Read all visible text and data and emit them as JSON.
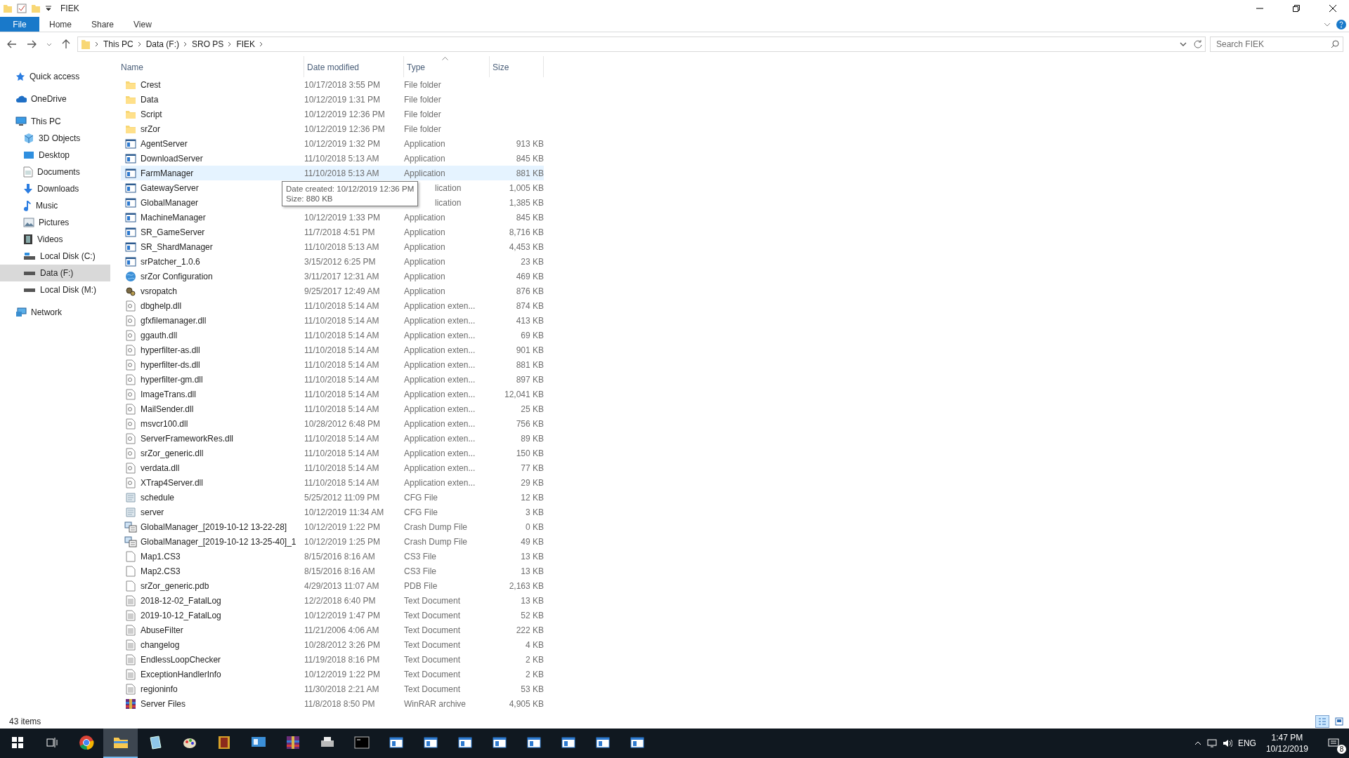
{
  "window": {
    "title": "FIEK"
  },
  "ribbon_tabs": [
    {
      "label": "File",
      "kind": "file"
    },
    {
      "label": "Home",
      "kind": "tab"
    },
    {
      "label": "Share",
      "kind": "tab"
    },
    {
      "label": "View",
      "kind": "tab"
    }
  ],
  "address": {
    "path": [
      "This PC",
      "Data (F:)",
      "SRO PS",
      "FIEK"
    ]
  },
  "search": {
    "placeholder": "Search FIEK"
  },
  "sidebar": {
    "items": [
      {
        "label": "Quick access",
        "selected": false
      },
      {
        "label": "OneDrive",
        "selected": false
      },
      {
        "label": "This PC",
        "selected": false,
        "children": [
          {
            "label": "3D Objects",
            "selected": false
          },
          {
            "label": "Desktop",
            "selected": false
          },
          {
            "label": "Documents",
            "selected": false
          },
          {
            "label": "Downloads",
            "selected": false
          },
          {
            "label": "Music",
            "selected": false
          },
          {
            "label": "Pictures",
            "selected": false
          },
          {
            "label": "Videos",
            "selected": false
          },
          {
            "label": "Local Disk (C:)",
            "selected": false
          },
          {
            "label": "Data (F:)",
            "selected": true
          },
          {
            "label": "Local Disk (M:)",
            "selected": false
          }
        ]
      },
      {
        "label": "Network",
        "selected": false
      }
    ]
  },
  "table": {
    "columns": [
      {
        "label": "Name",
        "sorted": false
      },
      {
        "label": "Date modified",
        "sorted": false
      },
      {
        "label": "Type",
        "sorted": true
      },
      {
        "label": "Size",
        "sorted": false
      }
    ],
    "rows": [
      {
        "name": "Crest",
        "modified": "10/17/2018 3:55 PM",
        "type": "File folder",
        "kind": "folder",
        "selected": false
      },
      {
        "name": "Data",
        "modified": "10/12/2019 1:31 PM",
        "type": "File folder",
        "kind": "folder",
        "selected": false
      },
      {
        "name": "Script",
        "modified": "10/12/2019 12:36 PM",
        "type": "File folder",
        "kind": "folder",
        "selected": false
      },
      {
        "name": "srZor",
        "modified": "10/12/2019 12:36 PM",
        "type": "File folder",
        "kind": "folder",
        "selected": false
      },
      {
        "name": "AgentServer",
        "modified": "10/12/2019 1:32 PM",
        "type": "Application",
        "size": "913 KB",
        "kind": "app",
        "selected": false
      },
      {
        "name": "DownloadServer",
        "modified": "11/10/2018 5:13 AM",
        "type": "Application",
        "size": "845 KB",
        "kind": "app",
        "selected": false
      },
      {
        "name": "FarmManager",
        "modified": "11/10/2018 5:13 AM",
        "type": "Application",
        "size": "881 KB",
        "kind": "app",
        "selected": true
      },
      {
        "name": "GatewayServer",
        "type": "lication",
        "size": "1,005 KB",
        "kind": "app",
        "selected": false
      },
      {
        "name": "GlobalManager",
        "type": "lication",
        "size": "1,385 KB",
        "kind": "app",
        "selected": false
      },
      {
        "name": "MachineManager",
        "modified": "10/12/2019 1:33 PM",
        "type": "Application",
        "size": "845 KB",
        "kind": "app",
        "selected": false
      },
      {
        "name": "SR_GameServer",
        "modified": "11/7/2018 4:51 PM",
        "type": "Application",
        "size": "8,716 KB",
        "kind": "app",
        "selected": false
      },
      {
        "name": "SR_ShardManager",
        "modified": "11/10/2018 5:13 AM",
        "type": "Application",
        "size": "4,453 KB",
        "kind": "app",
        "selected": false
      },
      {
        "name": "srPatcher_1.0.6",
        "modified": "3/15/2012 6:25 PM",
        "type": "Application",
        "size": "23 KB",
        "kind": "app",
        "selected": false
      },
      {
        "name": "srZor Configuration",
        "modified": "3/11/2017 12:31 AM",
        "type": "Application",
        "size": "469 KB",
        "kind": "globe",
        "selected": false
      },
      {
        "name": "vsropatch",
        "modified": "9/25/2017 12:49 AM",
        "type": "Application",
        "size": "876 KB",
        "kind": "gears",
        "selected": false
      },
      {
        "name": "dbghelp.dll",
        "modified": "11/10/2018 5:14 AM",
        "type": "Application exten...",
        "size": "874 KB",
        "kind": "dll",
        "selected": false
      },
      {
        "name": "gfxfilemanager.dll",
        "modified": "11/10/2018 5:14 AM",
        "type": "Application exten...",
        "size": "413 KB",
        "kind": "dll",
        "selected": false
      },
      {
        "name": "ggauth.dll",
        "modified": "11/10/2018 5:14 AM",
        "type": "Application exten...",
        "size": "69 KB",
        "kind": "dll",
        "selected": false
      },
      {
        "name": "hyperfilter-as.dll",
        "modified": "11/10/2018 5:14 AM",
        "type": "Application exten...",
        "size": "901 KB",
        "kind": "dll",
        "selected": false
      },
      {
        "name": "hyperfilter-ds.dll",
        "modified": "11/10/2018 5:14 AM",
        "type": "Application exten...",
        "size": "881 KB",
        "kind": "dll",
        "selected": false
      },
      {
        "name": "hyperfilter-gm.dll",
        "modified": "11/10/2018 5:14 AM",
        "type": "Application exten...",
        "size": "897 KB",
        "kind": "dll",
        "selected": false
      },
      {
        "name": "ImageTrans.dll",
        "modified": "11/10/2018 5:14 AM",
        "type": "Application exten...",
        "size": "12,041 KB",
        "kind": "dll",
        "selected": false
      },
      {
        "name": "MailSender.dll",
        "modified": "11/10/2018 5:14 AM",
        "type": "Application exten...",
        "size": "25 KB",
        "kind": "dll",
        "selected": false
      },
      {
        "name": "msvcr100.dll",
        "modified": "10/28/2012 6:48 PM",
        "type": "Application exten...",
        "size": "756 KB",
        "kind": "dll",
        "selected": false
      },
      {
        "name": "ServerFrameworkRes.dll",
        "modified": "11/10/2018 5:14 AM",
        "type": "Application exten...",
        "size": "89 KB",
        "kind": "dll",
        "selected": false
      },
      {
        "name": "srZor_generic.dll",
        "modified": "11/10/2018 5:14 AM",
        "type": "Application exten...",
        "size": "150 KB",
        "kind": "dll",
        "selected": false
      },
      {
        "name": "verdata.dll",
        "modified": "11/10/2018 5:14 AM",
        "type": "Application exten...",
        "size": "77 KB",
        "kind": "dll",
        "selected": false
      },
      {
        "name": "XTrap4Server.dll",
        "modified": "11/10/2018 5:14 AM",
        "type": "Application exten...",
        "size": "29 KB",
        "kind": "dll",
        "selected": false
      },
      {
        "name": "schedule",
        "modified": "5/25/2012 11:09 PM",
        "type": "CFG File",
        "size": "12 KB",
        "kind": "cfg",
        "selected": false
      },
      {
        "name": "server",
        "modified": "10/12/2019 11:34 AM",
        "type": "CFG File",
        "size": "3 KB",
        "kind": "cfg",
        "selected": false
      },
      {
        "name": "GlobalManager_[2019-10-12 13-22-28]",
        "modified": "10/12/2019 1:22 PM",
        "type": "Crash Dump File",
        "size": "0 KB",
        "kind": "dump",
        "selected": false
      },
      {
        "name": "GlobalManager_[2019-10-12 13-25-40]_1",
        "modified": "10/12/2019 1:25 PM",
        "type": "Crash Dump File",
        "size": "49 KB",
        "kind": "dump",
        "selected": false
      },
      {
        "name": "Map1.CS3",
        "modified": "8/15/2016 8:16 AM",
        "type": "CS3 File",
        "size": "13 KB",
        "kind": "blank",
        "selected": false
      },
      {
        "name": "Map2.CS3",
        "modified": "8/15/2016 8:16 AM",
        "type": "CS3 File",
        "size": "13 KB",
        "kind": "blank",
        "selected": false
      },
      {
        "name": "srZor_generic.pdb",
        "modified": "4/29/2013 11:07 AM",
        "type": "PDB File",
        "size": "2,163 KB",
        "kind": "blank",
        "selected": false
      },
      {
        "name": "2018-12-02_FatalLog",
        "modified": "12/2/2018 6:40 PM",
        "type": "Text Document",
        "size": "13 KB",
        "kind": "text",
        "selected": false
      },
      {
        "name": "2019-10-12_FatalLog",
        "modified": "10/12/2019 1:47 PM",
        "type": "Text Document",
        "size": "52 KB",
        "kind": "text",
        "selected": false
      },
      {
        "name": "AbuseFilter",
        "modified": "11/21/2006 4:06 AM",
        "type": "Text Document",
        "size": "222 KB",
        "kind": "text",
        "selected": false
      },
      {
        "name": "changelog",
        "modified": "10/28/2012 3:26 PM",
        "type": "Text Document",
        "size": "4 KB",
        "kind": "text",
        "selected": false
      },
      {
        "name": "EndlessLoopChecker",
        "modified": "11/19/2018 8:16 PM",
        "type": "Text Document",
        "size": "2 KB",
        "kind": "text",
        "selected": false
      },
      {
        "name": "ExceptionHandlerInfo",
        "modified": "10/12/2019 1:22 PM",
        "type": "Text Document",
        "size": "2 KB",
        "kind": "text",
        "selected": false
      },
      {
        "name": "regioninfo",
        "modified": "11/30/2018 2:21 AM",
        "type": "Text Document",
        "size": "53 KB",
        "kind": "text",
        "selected": false
      },
      {
        "name": "Server Files",
        "modified": "11/8/2018 8:50 PM",
        "type": "WinRAR archive",
        "size": "4,905 KB",
        "kind": "rar",
        "selected": false
      }
    ]
  },
  "tooltip": {
    "lines": [
      "Date created: 10/12/2019 12:36 PM",
      "Size: 880 KB"
    ]
  },
  "status_bar": {
    "text": "43 items",
    "view_buttons": [
      {
        "selected": true
      },
      {
        "selected": false
      }
    ]
  },
  "taskbar": {
    "apps": [
      {
        "selected": false
      },
      {
        "selected": false
      },
      {
        "selected": false
      },
      {
        "selected": true
      },
      {
        "selected": false
      },
      {
        "selected": false
      },
      {
        "selected": false
      },
      {
        "selected": false
      },
      {
        "selected": false
      },
      {
        "selected": false
      },
      {
        "selected": false
      },
      {
        "selected": false
      },
      {
        "selected": false
      },
      {
        "selected": false
      },
      {
        "selected": false
      },
      {
        "selected": false
      },
      {
        "selected": false
      },
      {
        "selected": false
      },
      {
        "selected": false
      }
    ],
    "language": "ENG",
    "time": "1:47 PM",
    "date": "10/12/2019",
    "notifications": "8"
  }
}
